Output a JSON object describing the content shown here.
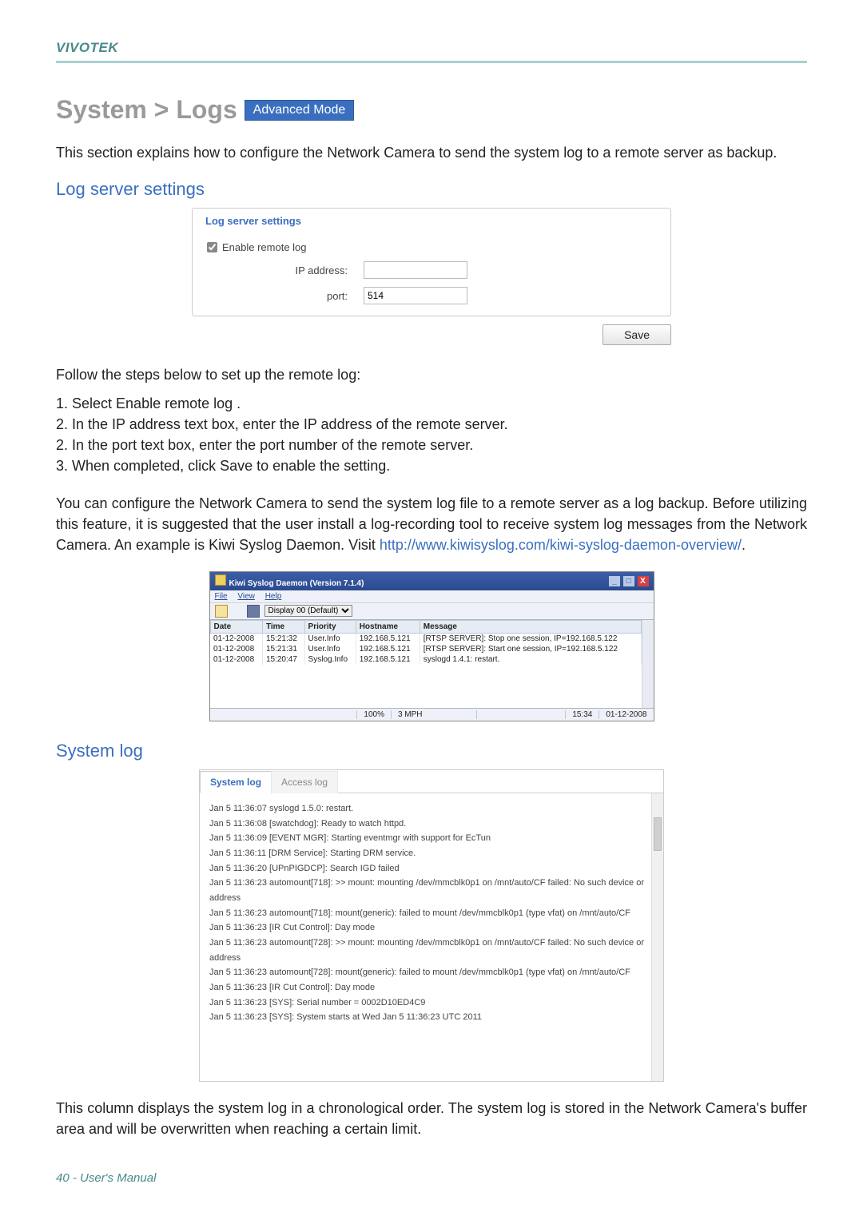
{
  "brand": "VIVOTEK",
  "title": "System > Logs",
  "badge": "Advanced Mode",
  "intro": "This section explains how to configure the Network Camera to send the system log to a remote server as backup.",
  "section_log_server": "Log server settings",
  "panel": {
    "legend": "Log server settings",
    "enable_label": "Enable remote log",
    "ip_label": "IP address:",
    "ip_value": "",
    "port_label": "port:",
    "port_value": "514"
  },
  "save_label": "Save",
  "follow_text": "Follow the steps below to set up the remote log:",
  "steps": [
    "Select Enable remote log .",
    "In the IP address text box, enter the IP address of the remote server.",
    "In the port text box, enter the port number of the remote server.",
    "When completed, click Save to enable the setting."
  ],
  "para2_a": "You can configure the Network Camera to send the system log file to a remote server as a log backup. Before utilizing this feature, it is suggested that the user install a log-recording tool to receive system log messages from the Network Camera. An example is Kiwi Syslog Daemon. Visit ",
  "para2_link": "http://www.kiwisyslog.com/kiwi-syslog-daemon-overview/",
  "para2_b": ".",
  "kiwi": {
    "title": "Kiwi Syslog Daemon (Version 7.1.4)",
    "menu": [
      "File",
      "View",
      "Help"
    ],
    "display": "Display 00 (Default)",
    "headers": [
      "Date",
      "Time",
      "Priority",
      "Hostname",
      "Message"
    ],
    "rows": [
      [
        "01-12-2008",
        "15:21:32",
        "User.Info",
        "192.168.5.121",
        "[RTSP SERVER]: Stop one session, IP=192.168.5.122"
      ],
      [
        "01-12-2008",
        "15:21:31",
        "User.Info",
        "192.168.5.121",
        "[RTSP SERVER]: Start one session, IP=192.168.5.122"
      ],
      [
        "01-12-2008",
        "15:20:47",
        "Syslog.Info",
        "192.168.5.121",
        "syslogd 1.4.1: restart."
      ]
    ],
    "status": {
      "pct": "100%",
      "rate": "3 MPH",
      "time": "15:34",
      "date": "01-12-2008"
    }
  },
  "section_system_log": "System log",
  "tabs": {
    "active": "System log",
    "inactive": "Access log"
  },
  "log_lines": [
    "Jan 5 11:36:07 syslogd 1.5.0: restart.",
    "Jan 5 11:36:08 [swatchdog]: Ready to watch httpd.",
    "Jan 5 11:36:09 [EVENT MGR]: Starting eventmgr with support for EcTun",
    "Jan 5 11:36:11 [DRM Service]: Starting DRM service.",
    "Jan 5 11:36:20 [UPnPIGDCP]: Search IGD failed",
    "Jan 5 11:36:23 automount[718]: >> mount: mounting /dev/mmcblk0p1 on /mnt/auto/CF failed: No such device or address",
    "Jan 5 11:36:23 automount[718]: mount(generic): failed to mount /dev/mmcblk0p1 (type vfat) on /mnt/auto/CF",
    "Jan 5 11:36:23 [IR Cut Control]: Day mode",
    "Jan 5 11:36:23 automount[728]: >> mount: mounting /dev/mmcblk0p1 on /mnt/auto/CF failed: No such device or address",
    "Jan 5 11:36:23 automount[728]: mount(generic): failed to mount /dev/mmcblk0p1 (type vfat) on /mnt/auto/CF",
    "Jan 5 11:36:23 [IR Cut Control]: Day mode",
    "Jan 5 11:36:23 [SYS]: Serial number = 0002D10ED4C9",
    "Jan 5 11:36:23 [SYS]: System starts at Wed Jan 5 11:36:23 UTC 2011"
  ],
  "outro": "This column displays the system log in a chronological order. The system log is stored in the Network Camera's buffer area and will be overwritten when reaching a certain limit.",
  "footer": "40 - User's Manual"
}
